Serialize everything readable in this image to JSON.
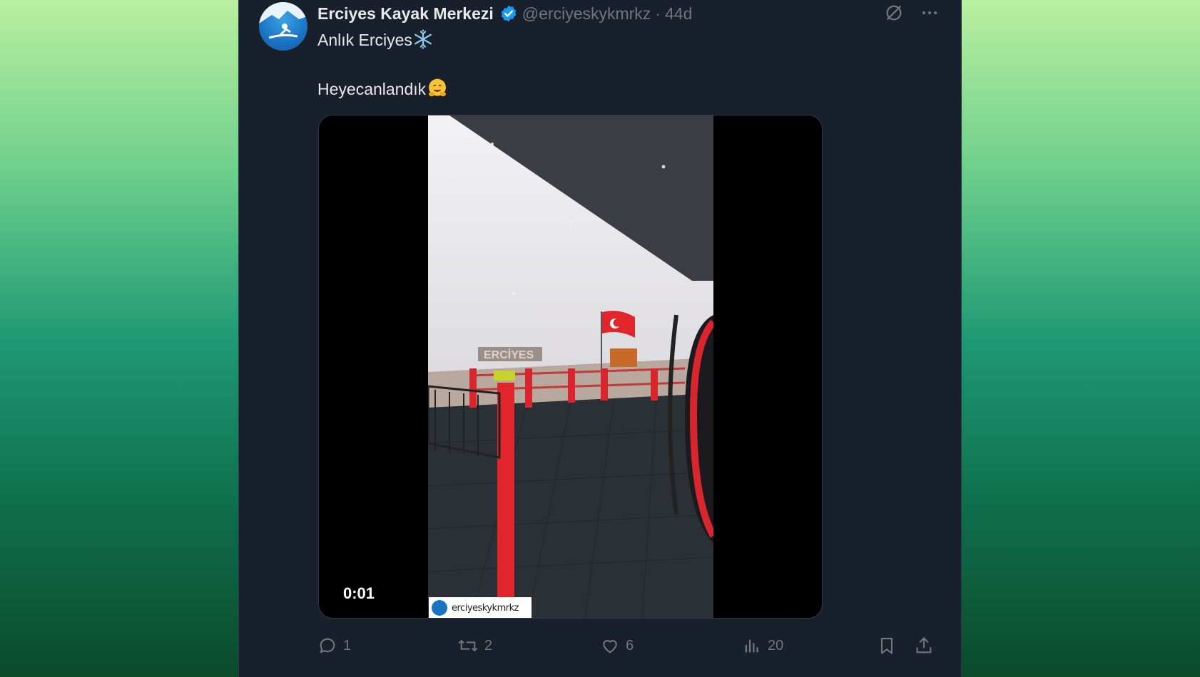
{
  "tweet": {
    "display_name": "Erciyes Kayak Merkezi",
    "handle": "@erciyeskykmrkz",
    "separator": "·",
    "age": "44d",
    "line1": "Anlık Erciyes",
    "line1_emoji": "snowflake-emoji",
    "line2": "Heyecanlandık",
    "line2_emoji": "hugging-face-emoji"
  },
  "media": {
    "timestamp": "0:01",
    "watermark": "erciyeskykmrkz",
    "sign_text": "ERCİYES"
  },
  "actions": {
    "replies": "1",
    "reposts": "2",
    "likes": "6",
    "views": "20"
  },
  "colors": {
    "card_bg": "#17202b",
    "text": "#e7e9ea",
    "muted": "#71767b",
    "verified": "#1d9bf0"
  }
}
